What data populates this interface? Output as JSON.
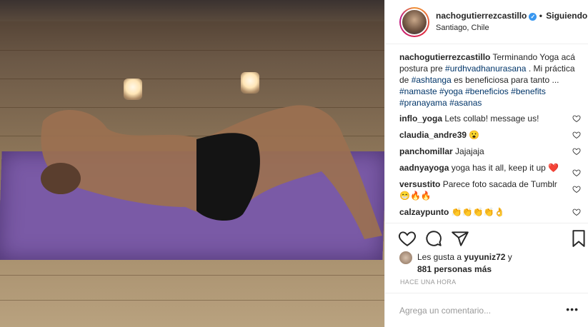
{
  "post": {
    "username": "nachogutierrezcastillo",
    "follow_separator": "•",
    "follow_label": "Siguiendo",
    "location": "Santiago, Chile",
    "verified_icon": "verified-badge-icon"
  },
  "caption": {
    "username": "nachogutierrezcastillo",
    "text_1": " Terminando Yoga acá postura pre ",
    "tag_1": "#urdhvadhanurasana",
    "text_2": " . Mi práctica de ",
    "tag_2": "#ashtanga",
    "text_3": " es beneficiosa para tanto ... ",
    "tag_3": "#namaste",
    "tag_4": "#yoga",
    "tag_5": "#beneficios",
    "tag_6": "#benefits",
    "tag_7": "#pranayama",
    "tag_8": "#asanas"
  },
  "comments": [
    {
      "user": "inflo_yoga",
      "text": " Lets collab! message us!"
    },
    {
      "user": "claudia_andre39",
      "text": " 😮"
    },
    {
      "user": "panchomillar",
      "text": " Jajajaja"
    },
    {
      "user": "aadnyayoga",
      "text": " yoga has it all, keep it up ❤️"
    },
    {
      "user": "versustito",
      "text": " Parece foto sacada de Tumblr 😁🔥🔥"
    },
    {
      "user": "calzaypunto",
      "text": " 👏👏👏👏👌"
    }
  ],
  "likes": {
    "prefix": "Les gusta a ",
    "user": "yuyuniz72",
    "mid": " y ",
    "count": "881 personas más"
  },
  "timestamp": "HACE UNA HORA",
  "add_comment": {
    "placeholder": "Agrega un comentario..."
  },
  "more_label": "•••",
  "colors": {
    "accent": "#3897f0",
    "hashtag": "#003569",
    "mat": "#7a5aa6"
  }
}
